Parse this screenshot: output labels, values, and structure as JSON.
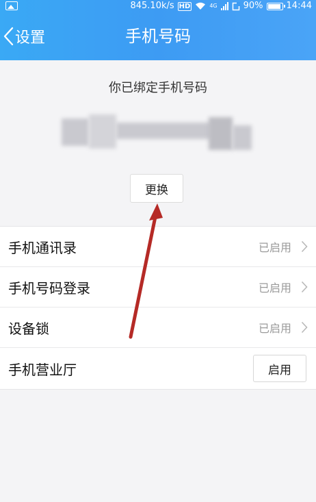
{
  "status_bar": {
    "speed": "845.10k/s",
    "hd": "HD",
    "network": "4G",
    "battery": "90%",
    "time": "14:44"
  },
  "header": {
    "back_label": "设置",
    "title": "手机号码"
  },
  "binding": {
    "label": "你已绑定手机号码",
    "change_button": "更换"
  },
  "settings": {
    "items": [
      {
        "label": "手机通讯录",
        "status": "已启用"
      },
      {
        "label": "手机号码登录",
        "status": "已启用"
      },
      {
        "label": "设备锁",
        "status": "已启用"
      },
      {
        "label": "手机营业厅",
        "button": "启用"
      }
    ]
  },
  "colors": {
    "header": "#3d9bf3",
    "annotation_arrow": "#b52a26"
  }
}
